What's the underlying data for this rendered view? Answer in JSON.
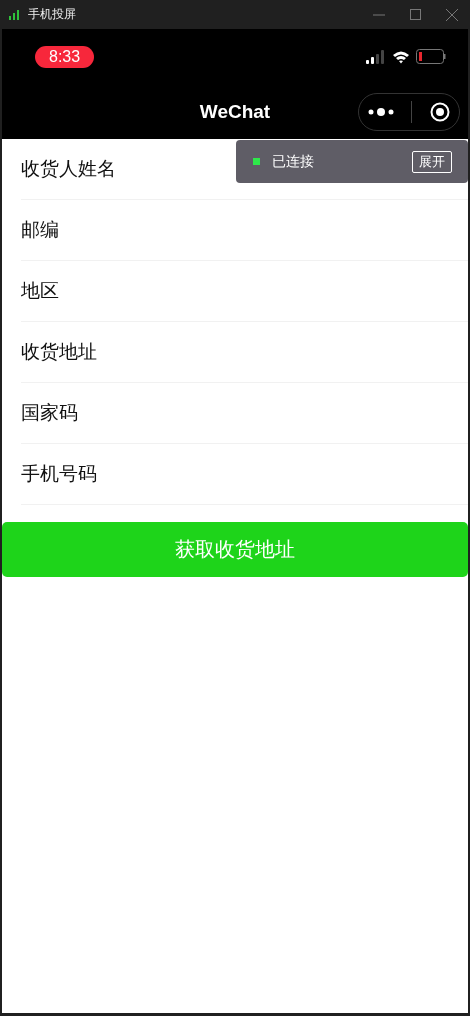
{
  "window": {
    "title": "手机投屏"
  },
  "status_bar": {
    "time": "8:33"
  },
  "nav": {
    "title": "WeChat"
  },
  "fields": [
    {
      "label": "收货人姓名"
    },
    {
      "label": "邮编"
    },
    {
      "label": "地区"
    },
    {
      "label": "收货地址"
    },
    {
      "label": "国家码"
    },
    {
      "label": "手机号码"
    }
  ],
  "action_button": "获取收货地址",
  "connection": {
    "connected": true,
    "text": "已连接",
    "button": "展开"
  }
}
